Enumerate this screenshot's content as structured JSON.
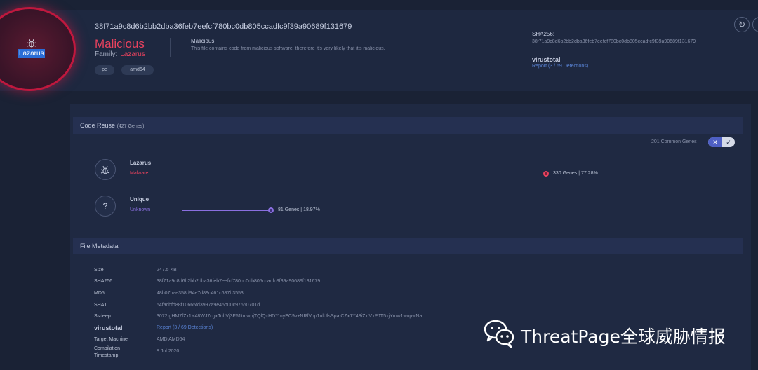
{
  "header": {
    "verdict_label": "Lazarus",
    "hash": "38f71a9c8d6b2bb2dba36feb7eefcf780bc0db805ccadfc9f39a90689f131679",
    "verdict": "Malicious",
    "family_label": "Family:",
    "family": "Lazarus",
    "desc_title": "Malicious",
    "desc_text": "This file contains code from malicious software, therefore it's very likely that it's malicious.",
    "tags": [
      "pe",
      "amd64"
    ],
    "sha256_label": "SHA256:",
    "sha256_value": "38f71a9c8d6b2bb2dba36feb7eefcf780bc0db805ccadfc9f39a90689f131679",
    "vt_logo": "virustotal",
    "vt_report": "Report (3 / 69 Detections)"
  },
  "code_reuse": {
    "title": "Code Reuse",
    "subtitle": "(427 Genes)",
    "common_genes": "201 Common Genes",
    "genes": [
      {
        "name": "Lazarus",
        "type": "Malware",
        "value": "330 Genes | 77.28%",
        "fraction": 0.7728,
        "color": "#e8425e",
        "icon": "bug-icon"
      },
      {
        "name": "Unique",
        "type": "Unknown",
        "value": "81 Genes | 18.97%",
        "fraction": 0.1897,
        "color": "#8a6fe0",
        "icon": "question-icon"
      }
    ]
  },
  "metadata": {
    "title": "File Metadata",
    "rows": [
      {
        "key": "Size",
        "value": "247.5 KB"
      },
      {
        "key": "SHA256",
        "value": "38f71a9c8d6b2bb2dba36feb7eefcf780bc0db805ccadfc9f39a90689f131679"
      },
      {
        "key": "MD5",
        "value": "48b07bae358d94e7d89c461c687b3553"
      },
      {
        "key": "SHA1",
        "value": "54facbfd88f10665fd3997a9e45b00c97660701d"
      },
      {
        "key": "Ssdeep",
        "value": "3072:gHM7fZx1Y48WJ7cgxTobVj3F51tmwpjTQlQxHDYmyEC9v+NRfVop1ulUlsSpa:CZx1Y48iZxiVxPJT5xjYmw1wopwNa"
      }
    ],
    "vt_logo": "virustotal",
    "vt_report": "Report (3 / 69 Detections)",
    "rows2": [
      {
        "key": "Target Machine",
        "value": "AMD AMD64"
      },
      {
        "key": "Compilation",
        "key2": "Timestamp",
        "value": "8 Jul 2020"
      }
    ]
  },
  "watermark": {
    "text": "ThreatPage全球威胁情报"
  },
  "colors": {
    "malicious": "#e8425e",
    "unknown": "#8a6fe0",
    "link": "#5a84d6",
    "background": "#1a2235"
  }
}
